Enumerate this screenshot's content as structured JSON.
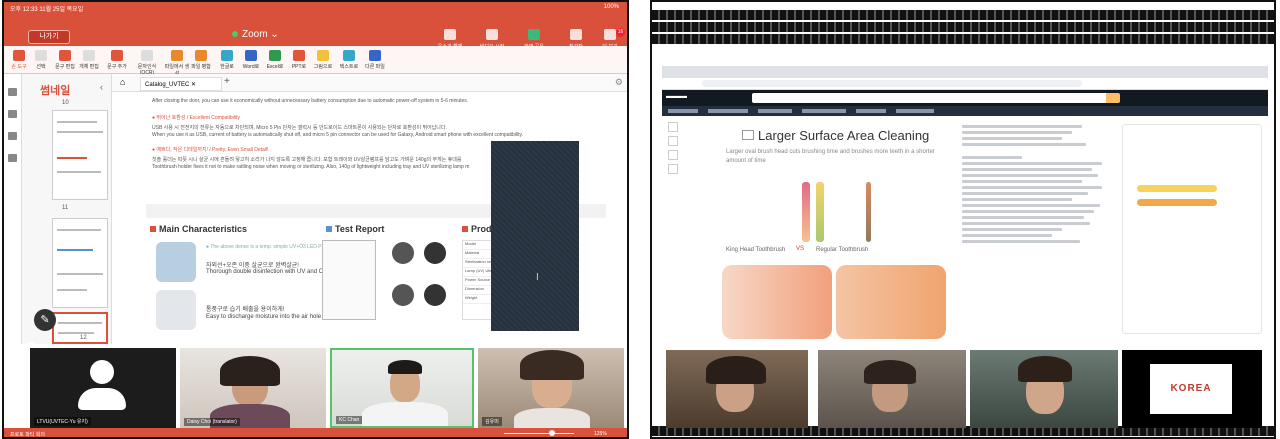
{
  "left_screen": {
    "status": {
      "time_date": "오후 12:33  11월 25일 목요일",
      "battery": "100%"
    },
    "top_bar": {
      "leave_label": "나가기",
      "app_title": "Zoom",
      "toolbar": [
        {
          "label": "음소거 해제",
          "icon": "mic-muted-icon"
        },
        {
          "label": "비디오 시작",
          "icon": "video-off-icon"
        },
        {
          "label": "화면 공유",
          "icon": "share-screen-icon"
        },
        {
          "label": "참가자",
          "icon": "participants-icon",
          "count": "5"
        },
        {
          "label": "더 보기",
          "icon": "more-icon",
          "badge": "16"
        }
      ]
    },
    "doc_toolbar": [
      {
        "label": "손 도구"
      },
      {
        "label": "선택"
      },
      {
        "label": "문구 편집"
      },
      {
        "label": "개체 편집"
      },
      {
        "label": "문구 추가"
      },
      {
        "label": "문자인식 (OCR)"
      },
      {
        "label": "파일에서 생성"
      },
      {
        "label": "파일 병합"
      },
      {
        "label": "한글로"
      },
      {
        "label": "Word로"
      },
      {
        "label": "Excel로"
      },
      {
        "label": "PPT로"
      },
      {
        "label": "그림으로"
      },
      {
        "label": "텍스트로"
      },
      {
        "label": "다른 파일"
      }
    ],
    "thumbnails": {
      "header": "썸네일",
      "pages": [
        "10",
        "11",
        "12"
      ]
    },
    "doc_tab": "Catalog_UVTEC",
    "page": {
      "lines": [
        "After closing the door, you can use it economically without unnecessary battery consumption due to automatic power-off system in 5-6 minutes.",
        "● 뛰어난 호환성 / Excellent Compatibility",
        "USB 사용 시 전전지의 전류는 자동으로 차단되며, Micro 5 Pin 단자는 갤럭시 등 안드로이드 스마트폰이 사용되는 단자로 호환성이 뛰어납니다.",
        "When you use it as USB, current of battery is automatically shut off, and micro 5 pin connector can be used for Galaxy, Android smart phone with excellent compatibility.",
        "● 예쁘다, 작은 디테일까지! / Pretty, Even Small Detail!",
        "칫솔 홀더는 따뜻 시니 살균 시에 흔들려 닿고히 소리가 나지 않도록 고정해 줍니다. 포함 트레이와 UV살균램프를 담고도 가벼운 140g의 무게는 휴대를",
        "Toothbrush holder fixes it not to make rattling noise when moving or sterilizing. Also, 140g of lightweight including tray and UV sterilizing lamp m"
      ],
      "sections": {
        "main": "Main Characteristics",
        "report": "Test Report",
        "prod": "Prod"
      },
      "features": [
        {
          "ko": "자외선+오존 이중 살균으로 완벽살균!",
          "en": "Thorough double disinfection with UV and Ozone"
        },
        {
          "ko": "통풍구로 습기 배출을 용이하게!",
          "en": "Easy to discharge moisture into the air hole"
        }
      ],
      "note": "● The above dense is a temp. simple UV+O3 LED Possible",
      "spec_rows": [
        "Model",
        "Material",
        "Sterilization method",
        "Lamp (UV) Ultra",
        "Power Source",
        "Dimension",
        "Weight"
      ]
    },
    "participants": [
      {
        "name": "LTVU(UVTEC-Yu 유지)",
        "video": false
      },
      {
        "name": "Daisy Choi (translator)",
        "video": true
      },
      {
        "name": "KC Chan",
        "video": true
      },
      {
        "name": "김유미",
        "video": true
      }
    ],
    "footer": {
      "left": "프로토 파티 회의",
      "zoom": "125%"
    }
  },
  "right_screen": {
    "product_heading": "Larger Surface Area Cleaning",
    "product_subheading": "Larger oval brush head cuts brushing time and brushes more teeth in a shorter amount of time",
    "caption_left": "King Head Toothbrush",
    "caption_vs": "VS",
    "caption_right": "Regular Toothbrush",
    "tile_logo": "KOREA"
  },
  "colors": {
    "zoom_red": "#d9513b",
    "amazon_dark": "#131921",
    "speaker_green": "#56c26a"
  }
}
